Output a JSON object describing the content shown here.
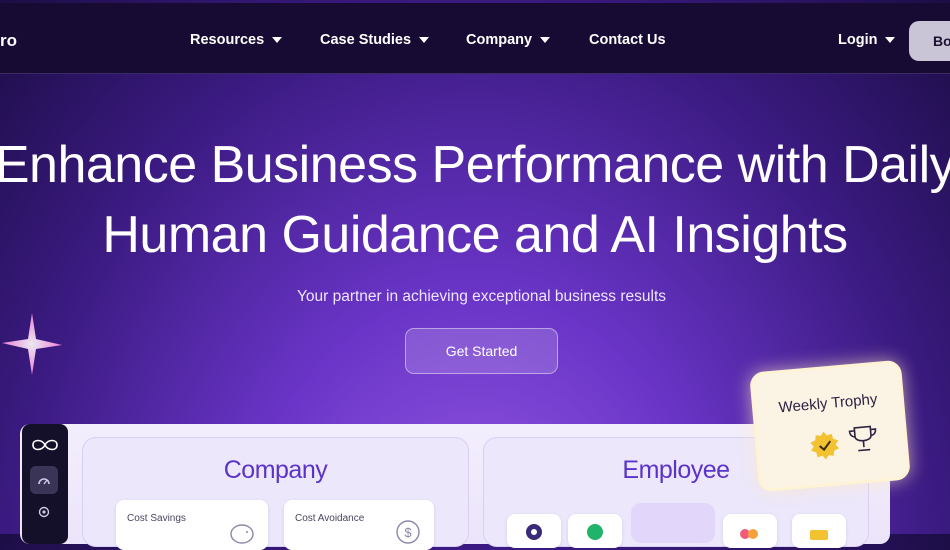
{
  "nav": {
    "logo_fragment": "ro",
    "items": [
      {
        "label": "Resources"
      },
      {
        "label": "Case Studies"
      },
      {
        "label": "Company"
      },
      {
        "label": "Contact Us"
      }
    ],
    "login_label": "Login",
    "book_label": "Bo"
  },
  "hero": {
    "title_line1": "Enhance Business Performance with Daily",
    "title_line2": "Human Guidance and AI Insights",
    "subtitle": "Your partner in achieving exceptional business results",
    "cta_label": "Get Started"
  },
  "dashboard": {
    "company_card": {
      "title": "Company",
      "metrics": [
        {
          "label": "Cost Savings",
          "icon": "piggy-bank-icon"
        },
        {
          "label": "Cost Avoidance",
          "icon": "dollar-coin-icon"
        }
      ]
    },
    "employee_card": {
      "title": "Employee"
    }
  },
  "trophy_card": {
    "title": "Weekly Trophy"
  },
  "colors": {
    "nav_bg": "#180b33",
    "accent_purple": "#5b33c9",
    "badge_gold": "#f2c230"
  }
}
